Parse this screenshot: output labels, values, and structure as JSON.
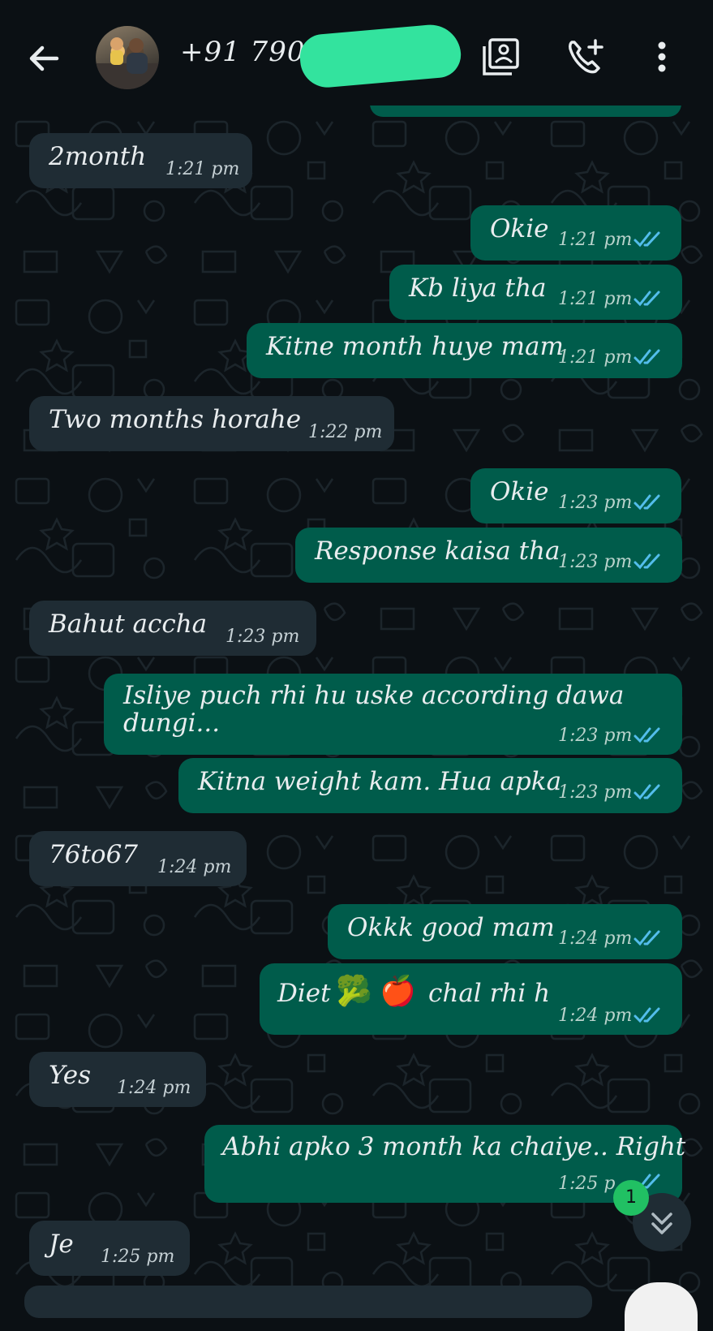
{
  "header": {
    "phone_number": "+91 79052",
    "icons": [
      "back-arrow-icon",
      "avatar",
      "contact-card-icon",
      "add-call-icon",
      "more-vert-icon"
    ]
  },
  "messages": [
    {
      "dir": "in",
      "text": "2month",
      "time": "1:21 pm"
    },
    {
      "dir": "out",
      "text": "Okie",
      "time": "1:21 pm",
      "ticks": "read"
    },
    {
      "dir": "out",
      "text": "Kb liya tha",
      "time": "1:21 pm",
      "ticks": "read"
    },
    {
      "dir": "out",
      "text": "Kitne month huye mam",
      "time": "1:21 pm",
      "ticks": "read"
    },
    {
      "dir": "in",
      "text": "Two months horahe",
      "time": "1:22 pm"
    },
    {
      "dir": "out",
      "text": "Okie",
      "time": "1:23 pm",
      "ticks": "read"
    },
    {
      "dir": "out",
      "text": "Response kaisa tha",
      "time": "1:23 pm",
      "ticks": "read"
    },
    {
      "dir": "in",
      "text": "Bahut accha",
      "time": "1:23 pm"
    },
    {
      "dir": "out",
      "text_line1": "Isliye puch rhi hu uske according dawa",
      "text_line2": "dungi...",
      "time": "1:23 pm",
      "ticks": "read"
    },
    {
      "dir": "out",
      "text": "Kitna weight kam. Hua apka",
      "time": "1:23 pm",
      "ticks": "read"
    },
    {
      "dir": "in",
      "text": "76to67",
      "time": "1:24 pm"
    },
    {
      "dir": "out",
      "text": "Okkk good mam",
      "time": "1:24 pm",
      "ticks": "read"
    },
    {
      "dir": "out",
      "text_pre": "Diet",
      "emoji1": "🥦",
      "emoji2": "🍎",
      "text_post": "chal rhi h",
      "time": "1:24 pm",
      "ticks": "read"
    },
    {
      "dir": "in",
      "text": "Yes",
      "time": "1:24 pm"
    },
    {
      "dir": "out",
      "text": "Abhi apko 3 month ka chaiye.. Right",
      "time": "1:25 p",
      "ticks": "read"
    },
    {
      "dir": "in",
      "text": "Je",
      "time": "1:25 pm"
    }
  ],
  "unread_badge": "1",
  "colors": {
    "background": "#0b1014",
    "incoming_bubble": "#1f2c34",
    "outgoing_bubble": "#005c4b",
    "read_tick": "#53bdeb",
    "badge": "#21c063",
    "redaction": "#33e39e"
  }
}
